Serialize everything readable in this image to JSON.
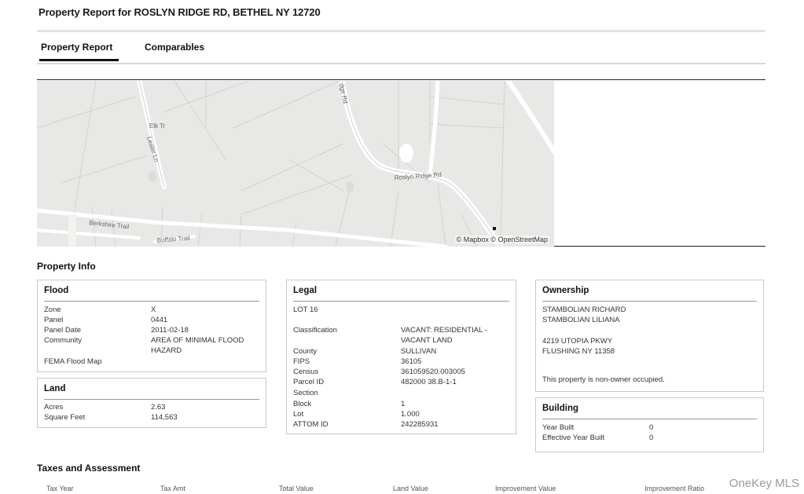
{
  "page": {
    "title": "Property Report for ROSLYN RIDGE RD, BETHEL NY 12720"
  },
  "tabs": [
    {
      "label": "Property Report",
      "active": true
    },
    {
      "label": "Comparables",
      "active": false
    }
  ],
  "map": {
    "attribution": "© Mapbox © OpenStreetMap",
    "labels": {
      "elk_tr": "Elk Tr",
      "lester_ln": "Lester Ln",
      "ridge_rd_top": "dge Rd",
      "roslyn_ridge_rd": "Roslyn Ridge Rd",
      "berkshire_trail": "Berkshire Trail",
      "buffalo_trail": "Buffalo Trail"
    }
  },
  "property_info": {
    "heading": "Property Info",
    "flood": {
      "heading": "Flood",
      "rows": [
        {
          "label": "Zone",
          "value": "X"
        },
        {
          "label": "Panel",
          "value": "0441"
        },
        {
          "label": "Panel Date",
          "value": "2011-02-18"
        },
        {
          "label": "Community",
          "value": "AREA OF MINIMAL FLOOD"
        },
        {
          "label": "",
          "value": "HAZARD"
        },
        {
          "label": "FEMA Flood Map",
          "value": ""
        }
      ]
    },
    "land": {
      "heading": "Land",
      "rows": [
        {
          "label": "Acres",
          "value": "2.63"
        },
        {
          "label": "Square Feet",
          "value": "114,563"
        }
      ]
    },
    "legal": {
      "heading": "Legal",
      "lot_line": "LOT 16",
      "rows": [
        {
          "label": "Classification",
          "value": "VACANT: RESIDENTIAL -"
        },
        {
          "label": "",
          "value": "VACANT LAND"
        },
        {
          "label": "County",
          "value": "SULLIVAN"
        },
        {
          "label": "FIPS",
          "value": "36105"
        },
        {
          "label": "Census",
          "value": "361059520.003005"
        },
        {
          "label": "Parcel ID",
          "value": "482000 38.B-1-1"
        },
        {
          "label": "Section",
          "value": ""
        },
        {
          "label": "Block",
          "value": "1"
        },
        {
          "label": "Lot",
          "value": "1.000"
        },
        {
          "label": "ATTOM ID",
          "value": "242285931"
        }
      ]
    },
    "ownership": {
      "heading": "Ownership",
      "owner1": "STAMBOLIAN RICHARD",
      "owner2": "STAMBOLIAN LILIANA",
      "address1": "4219 UTOPIA PKWY",
      "address2": "FLUSHING NY 11358",
      "note": "This property is non-owner occupied."
    },
    "building": {
      "heading": "Building",
      "rows": [
        {
          "label": "Year Built",
          "value": "0"
        },
        {
          "label": "Effective Year Built",
          "value": "0"
        }
      ]
    }
  },
  "taxes": {
    "heading": "Taxes and Assessment",
    "columns": [
      "Tax Year",
      "Tax Amt",
      "Total Value",
      "Land Value",
      "Improvement Value",
      "Improvement Ratio"
    ]
  },
  "watermark": "OneKey MLS"
}
